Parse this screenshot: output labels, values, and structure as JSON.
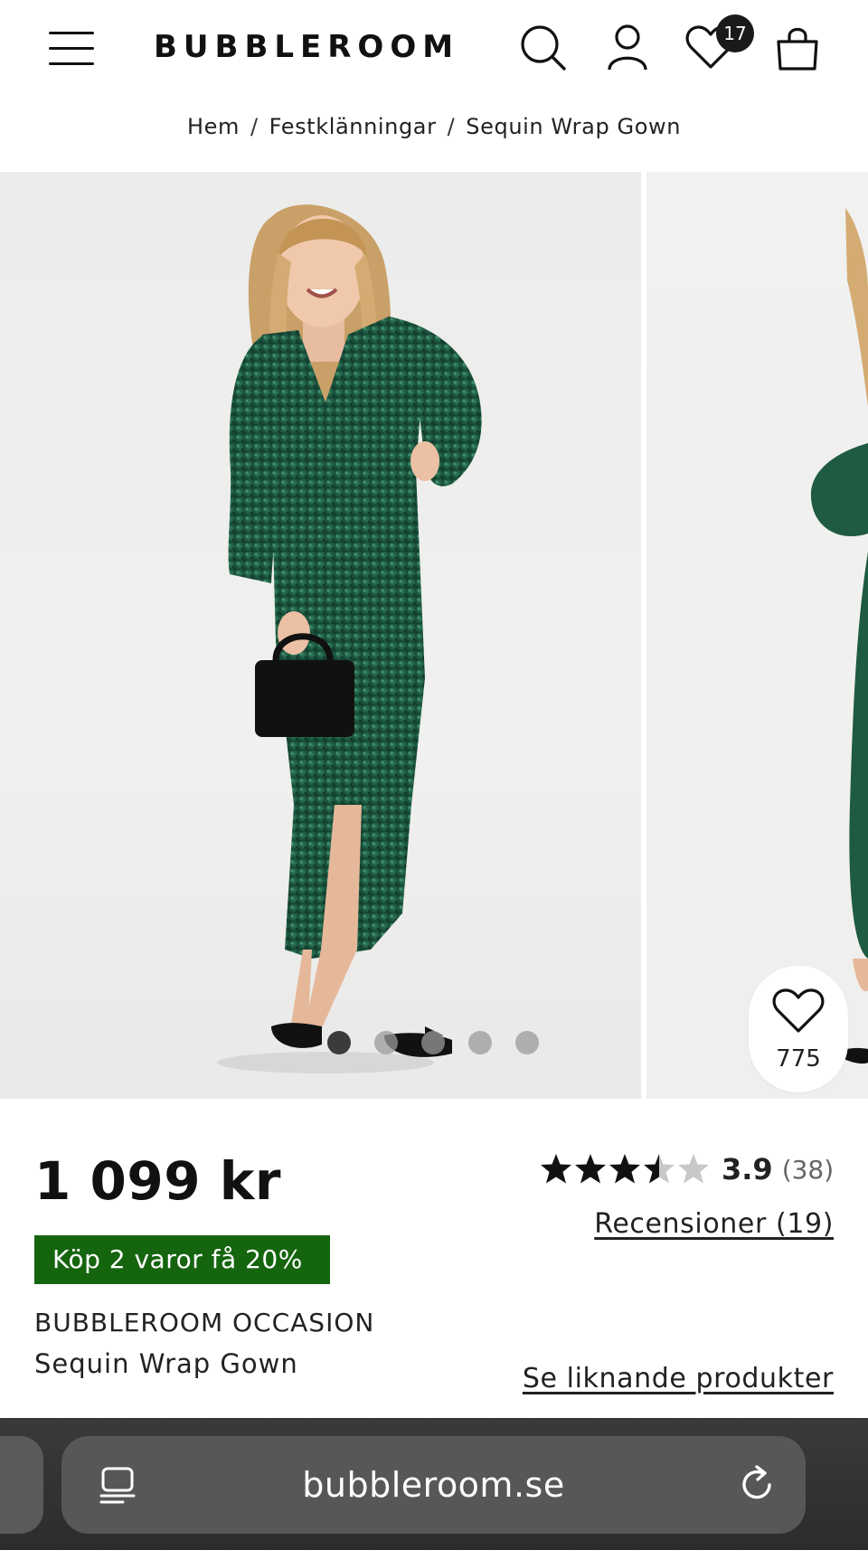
{
  "header": {
    "logo": "BUBBLEROOM",
    "wishlist_count": "17",
    "icons": [
      "menu-icon",
      "search-icon",
      "account-icon",
      "heart-icon",
      "shopping-bag-icon"
    ]
  },
  "breadcrumb": {
    "items": [
      "Hem",
      "Festklänningar",
      "Sequin Wrap Gown"
    ]
  },
  "gallery": {
    "image_count": 5,
    "active_index": 0,
    "favorites_count": "775"
  },
  "product": {
    "price": "1 099 kr",
    "promo": "Köp 2 varor få 20%",
    "brand": "BUBBLEROOM OCCASION",
    "name": "Sequin Wrap Gown",
    "rating": {
      "value": "3.9",
      "stars_filled": 3.5,
      "stars_max": 5,
      "count": "(38)"
    },
    "reviews_label": "Recensioner (19)",
    "similar_label": "Se liknande produkter"
  },
  "browser": {
    "url": "bubbleroom.se"
  },
  "colors": {
    "promo_bg": "#15650f",
    "dress": "#1f5a42",
    "text": "#111111",
    "browser_bar": "#2f2f2f"
  }
}
